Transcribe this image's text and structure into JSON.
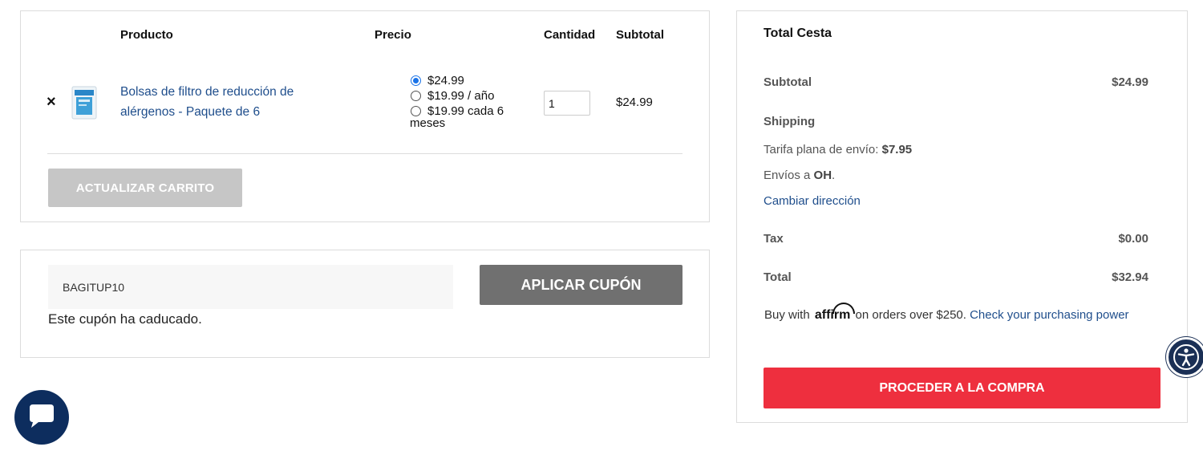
{
  "cart": {
    "headers": {
      "product": "Producto",
      "price": "Precio",
      "quantity": "Cantidad",
      "subtotal": "Subtotal"
    },
    "item": {
      "remove_icon": "×",
      "name_line1": "Bolsas de filtro de reducción de",
      "name_line2": "alérgenos - Paquete de 6",
      "price_options": [
        {
          "label": "$24.99",
          "selected": true
        },
        {
          "label": "$19.99 / año",
          "selected": false
        },
        {
          "label": "$19.99 cada 6",
          "label2": "meses",
          "selected": false
        }
      ],
      "quantity": "1",
      "subtotal": "$24.99"
    },
    "update_button": "ACTUALIZAR CARRITO"
  },
  "coupon": {
    "code": "BAGITUP10",
    "apply_button": "APLICAR CUPÓN",
    "message": "Este cupón ha caducado."
  },
  "totals": {
    "title": "Total Cesta",
    "subtotal_label": "Subtotal",
    "subtotal_value": "$24.99",
    "shipping_label": "Shipping",
    "shipping_rate_text": "Tarifa plana de envío: ",
    "shipping_rate_value": "$7.95",
    "ships_to_text": "Envíos a ",
    "ships_to_state": "OH",
    "ships_to_suffix": ".",
    "change_address": "Cambiar dirección",
    "tax_label": "Tax",
    "tax_value": "$0.00",
    "total_label": "Total",
    "total_value": "$32.94",
    "affirm_prefix": "Buy with",
    "affirm_logo": "affirm",
    "affirm_suffix": "on orders over $250.",
    "affirm_link": "Check your purchasing power",
    "checkout_button": "PROCEDER A LA COMPRA"
  },
  "colors": {
    "link": "#1f4e8c",
    "checkout": "#ee2f3e",
    "update_disabled": "#c6c6c6",
    "coupon_button": "#707070",
    "chat_bubble": "#0d2d5e"
  },
  "icons": {
    "remove": "close-icon",
    "accessibility": "accessibility-icon",
    "chat": "chat-icon"
  }
}
